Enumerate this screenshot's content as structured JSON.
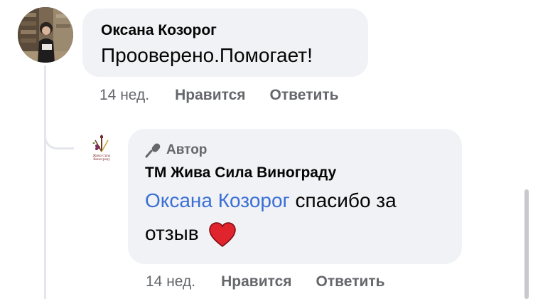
{
  "comment": {
    "author": "Оксана Козорог",
    "text": "Прооверено.Помогает!",
    "time": "14 нед.",
    "like_label": "Нравится",
    "reply_label": "Ответить"
  },
  "reply": {
    "badge_icon": "microphone-icon",
    "badge_label": "Автор",
    "author": "ТМ Жива Сила Винограду",
    "mention": "Оксана Козорог",
    "text_after_mention": " спасибо за",
    "text_line2": "отзыв",
    "emoji_icon": "red-heart-icon",
    "time": "14 нед.",
    "like_label": "Нравится",
    "reply_label": "Ответить"
  },
  "logo_text": {
    "line1": "Жива Сила",
    "line2": "Винограду"
  },
  "colors": {
    "bubble_bg": "#f0f2f5",
    "text_primary": "#050505",
    "text_secondary": "#65676b",
    "mention": "#3b6fd6",
    "heart": "#e0242e"
  }
}
